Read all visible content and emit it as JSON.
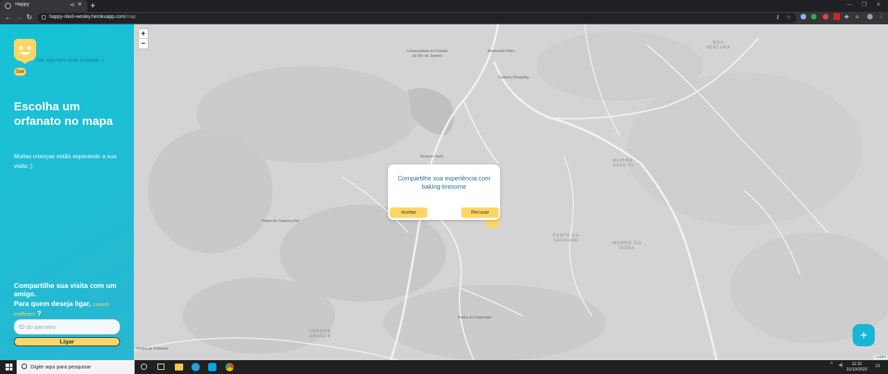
{
  "browser": {
    "tab_title": "Happy",
    "url_host": "happy-nlw3-wesley.herokuapp.com",
    "url_path": "/map"
  },
  "sidebar": {
    "welcome": "Olá, seja bem vindo Exemplo :)",
    "logout_label": "Sair",
    "headline": "Escolha um orfanato no mapa",
    "subtext": "Muitas crianças estão esperando a sua visita :)",
    "share_title": "Compartilhe sua visita com um amigo.",
    "share_question": "Para quem deseja ligar,",
    "partner_name": "coward-indifferent",
    "question_mark": "?",
    "partner_id_placeholder": "ID do parceiro",
    "call_label": "Ligar"
  },
  "map": {
    "zoom_in": "+",
    "zoom_out": "−",
    "labels": {
      "university": "Universidade do Estado do Rio de Janeiro",
      "maracana": "Maracanã Patro",
      "cadmo": "Cadeira Shopping",
      "bairro_joao": "BAIRRO JOÃO VI",
      "boa_ventura": "BOA VENTURA",
      "ponte": "PONTE DA SAUDADE",
      "morro": "MORRO DO MOSA",
      "varzea": "VARGEM GRANDE",
      "pedra_catarina": "Pedra do Catarina Rei",
      "pedra_piramide": "Pedra da Pirâmide",
      "pedra_imperador": "Pedra do Imperador",
      "bosque": "Bosque Darfy"
    },
    "attribution": "Leaflet"
  },
  "modal": {
    "title": "Compartilhe sua experiência com baking-tiresome",
    "accept": "Aceitar",
    "decline": "Recusar"
  },
  "fab_label": "+",
  "taskbar": {
    "search_placeholder": "Digite aqui para pesquisar",
    "time": "11:32",
    "date": "31/10/2020",
    "notifications": "21"
  }
}
